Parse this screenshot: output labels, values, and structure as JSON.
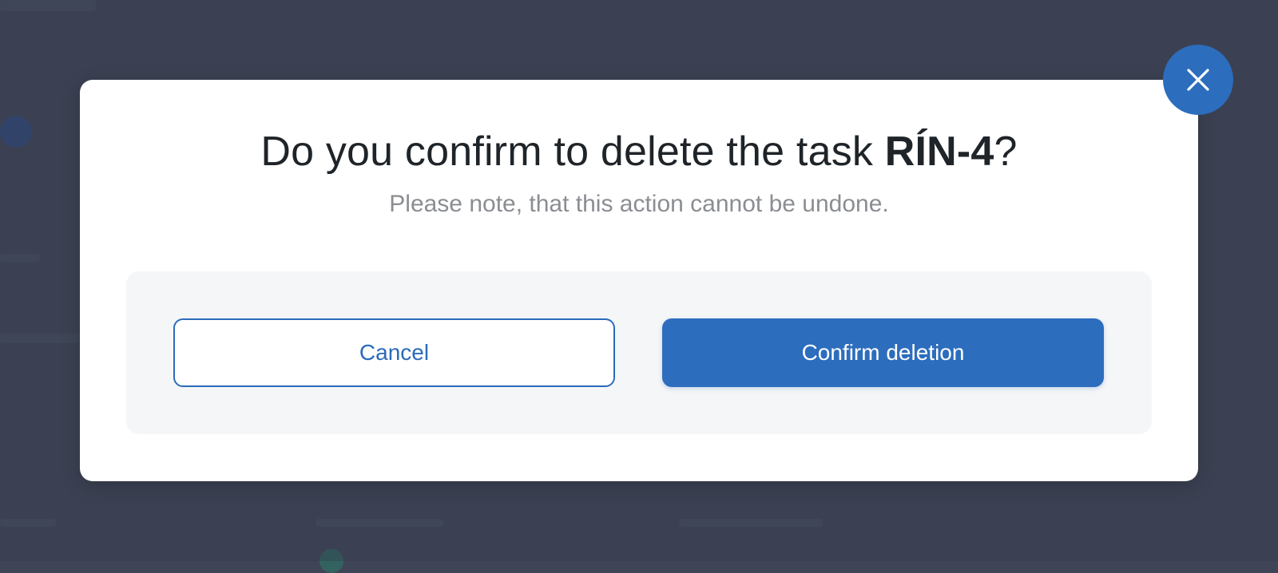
{
  "dialog": {
    "title_prefix": "Do you confirm to delete the task ",
    "task_id": "RÍN-4",
    "title_suffix": "?",
    "subtitle": "Please note, that this action cannot be undone.",
    "cancel_label": "Cancel",
    "confirm_label": "Confirm deletion",
    "close_icon": "close-icon"
  },
  "colors": {
    "accent": "#2c6dbd",
    "backdrop": "#3f4556",
    "title_text": "#1f2429",
    "subtitle_text": "#8a8d92",
    "panel_background": "#f5f6f8"
  }
}
